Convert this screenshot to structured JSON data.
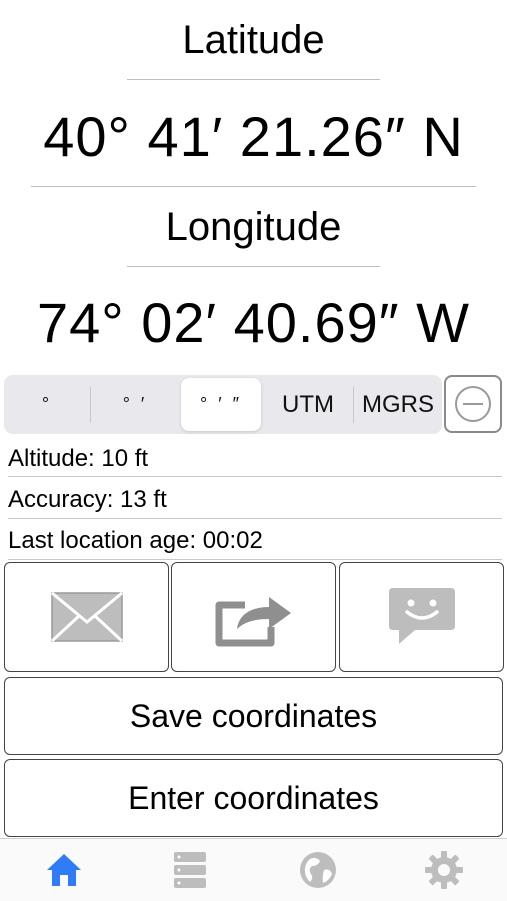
{
  "latitude": {
    "label": "Latitude",
    "value": "40° 41′ 21.26″ N"
  },
  "longitude": {
    "label": "Longitude",
    "value": "74° 02′ 40.69″ W"
  },
  "format_selector": {
    "options": [
      "°",
      "° ′",
      "° ′ ″",
      "UTM",
      "MGRS"
    ],
    "selected": "° ′ ″"
  },
  "info": {
    "altitude": "Altitude: 10 ft",
    "accuracy": "Accuracy: 13 ft",
    "location_age": "Last location age: 00:02"
  },
  "share_buttons": {
    "icons": [
      "mail-icon",
      "share-icon",
      "message-icon"
    ]
  },
  "buttons": {
    "save": "Save coordinates",
    "enter": "Enter coordinates"
  },
  "tabs": {
    "icons": [
      "home-icon",
      "list-icon",
      "globe-icon",
      "gear-icon"
    ],
    "active": "home-icon"
  },
  "colors": {
    "accent": "#2f7cf6",
    "inactive_icon": "#bdbdbd",
    "share_icon": "#8f8f8f"
  }
}
